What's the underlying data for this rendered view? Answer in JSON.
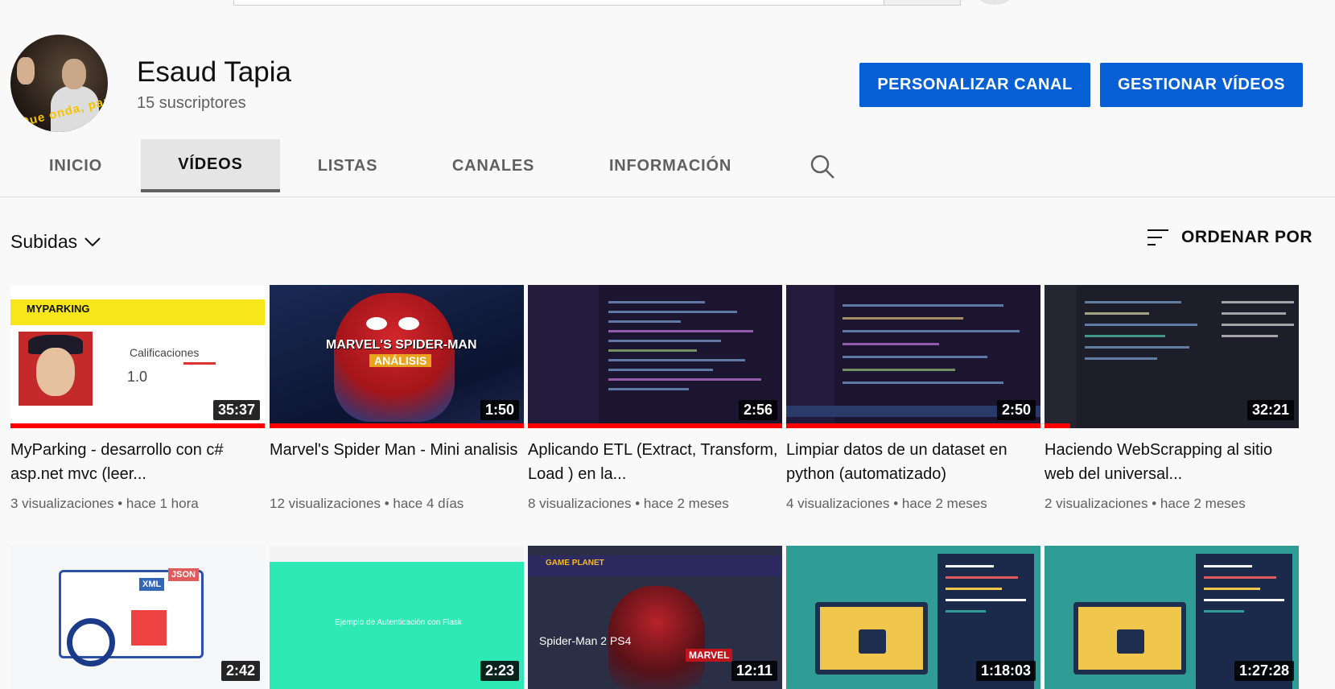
{
  "channel": {
    "name": "Esaud Tapia",
    "subscribers": "15 suscriptores",
    "avatar_text": "Que onda, papu",
    "customize_label": "PERSONALIZAR CANAL",
    "manage_label": "GESTIONAR VÍDEOS"
  },
  "tabs": [
    {
      "label": "INICIO",
      "active": false
    },
    {
      "label": "VÍDEOS",
      "active": true
    },
    {
      "label": "LISTAS",
      "active": false
    },
    {
      "label": "CANALES",
      "active": false
    },
    {
      "label": "INFORMACIÓN",
      "active": false
    }
  ],
  "filter": {
    "label": "Subidas"
  },
  "sort": {
    "label": "ORDENAR POR"
  },
  "videos": [
    {
      "title": "MyParking - desarrollo con c# asp.net mvc (leer...",
      "duration": "35:37",
      "views": "3 visualizaciones",
      "age": "hace 1 hora",
      "progress": 1.0,
      "thumb_texts": {
        "logo": "MYPARKING",
        "heading": "Calificaciones",
        "rating": "1.0"
      }
    },
    {
      "title": "Marvel's Spider Man - Mini analisis",
      "duration": "1:50",
      "views": "12 visualizaciones",
      "age": "hace 4 días",
      "progress": 1.0,
      "thumb_texts": {
        "title": "MARVEL'S SPIDER-MAN",
        "subtitle": "ANÁLISIS"
      }
    },
    {
      "title": "Aplicando ETL (Extract, Transform, Load ) en la...",
      "duration": "2:56",
      "views": "8 visualizaciones",
      "age": "hace 2 meses",
      "progress": 1.0
    },
    {
      "title": "Limpiar datos de un dataset en python (automatizado)",
      "duration": "2:50",
      "views": "4 visualizaciones",
      "age": "hace 2 meses",
      "progress": 1.0
    },
    {
      "title": "Haciendo WebScrapping al sitio web del universal...",
      "duration": "32:21",
      "views": "2 visualizaciones",
      "age": "hace 2 meses",
      "progress": 0.1
    },
    {
      "title": "",
      "duration": "2:42",
      "views": "",
      "age": "",
      "progress": 0,
      "thumb_texts": {
        "tag1": "XML",
        "tag2": "JSON"
      }
    },
    {
      "title": "",
      "duration": "2:23",
      "views": "",
      "age": "",
      "progress": 0,
      "thumb_texts": {
        "text": "Ejemplo de Autenticación con Flask"
      }
    },
    {
      "title": "",
      "duration": "12:11",
      "views": "",
      "age": "",
      "progress": 0,
      "thumb_texts": {
        "brand": "GAME PLANET",
        "title": "Spider-Man 2 PS4",
        "badge": "MARVEL"
      }
    },
    {
      "title": "",
      "duration": "1:18:03",
      "views": "",
      "age": "",
      "progress": 0
    },
    {
      "title": "",
      "duration": "1:27:28",
      "views": "",
      "age": "",
      "progress": 0
    }
  ],
  "colors": {
    "accent": "#065fd4",
    "progress": "#ff0000"
  }
}
